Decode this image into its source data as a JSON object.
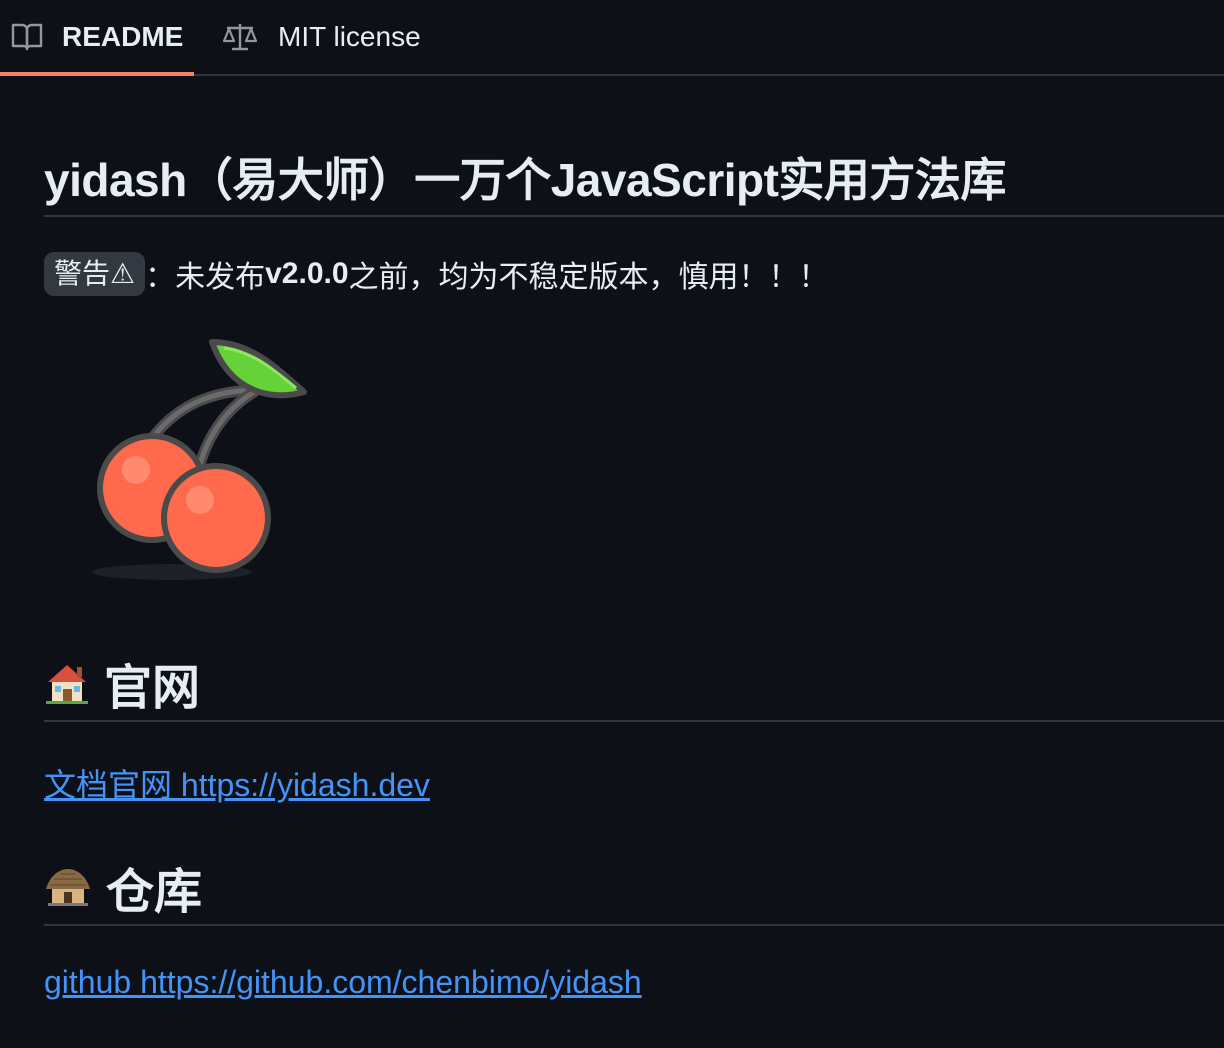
{
  "tabs": [
    {
      "label": "README",
      "icon": "book-icon",
      "active": true
    },
    {
      "label": "MIT license",
      "icon": "scale-icon",
      "active": false
    }
  ],
  "readme": {
    "title": "yidash（易大师）一万个JavaScript实用方法库",
    "warning": {
      "badge": "警告⚠",
      "prefix": "：未发布 ",
      "version": "v2.0.0",
      "suffix": " 之前，均为不稳定版本，慎用！！！"
    },
    "logo_icon": "cherries-icon",
    "sections": [
      {
        "emoji": "house-icon",
        "heading": "官网",
        "link_text": "文档官网 https://yidash.dev"
      },
      {
        "emoji": "hut-icon",
        "heading": "仓库",
        "link_text": "github https://github.com/chenbimo/yidash"
      }
    ]
  },
  "colors": {
    "background": "#0d1117",
    "text": "#e6edf3",
    "link": "#4493f8",
    "tab_underline": "#f78166",
    "border": "#30363d"
  }
}
